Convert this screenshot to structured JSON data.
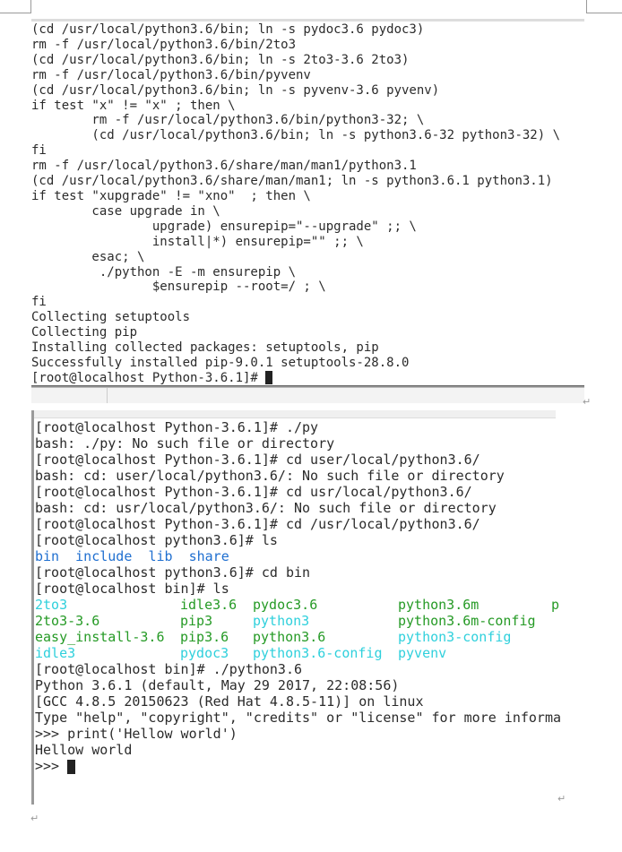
{
  "terminal_top": {
    "lines": [
      "(cd /usr/local/python3.6/bin; ln -s pydoc3.6 pydoc3)",
      "rm -f /usr/local/python3.6/bin/2to3",
      "(cd /usr/local/python3.6/bin; ln -s 2to3-3.6 2to3)",
      "rm -f /usr/local/python3.6/bin/pyvenv",
      "(cd /usr/local/python3.6/bin; ln -s pyvenv-3.6 pyvenv)",
      "if test \"x\" != \"x\" ; then \\",
      "        rm -f /usr/local/python3.6/bin/python3-32; \\",
      "        (cd /usr/local/python3.6/bin; ln -s python3.6-32 python3-32) \\",
      "fi",
      "rm -f /usr/local/python3.6/share/man/man1/python3.1",
      "(cd /usr/local/python3.6/share/man/man1; ln -s python3.6.1 python3.1)",
      "if test \"xupgrade\" != \"xno\"  ; then \\",
      "        case upgrade in \\",
      "                upgrade) ensurepip=\"--upgrade\" ;; \\",
      "                install|*) ensurepip=\"\" ;; \\",
      "        esac; \\",
      "         ./python -E -m ensurepip \\",
      "                $ensurepip --root=/ ; \\",
      "fi",
      "Collecting setuptools",
      "Collecting pip",
      "Installing collected packages: setuptools, pip",
      "Successfully installed pip-9.0.1 setuptools-28.8.0",
      "[root@localhost Python-3.6.1]# "
    ]
  },
  "terminal_bottom": {
    "lines_before": [
      "[root@localhost Python-3.6.1]# ./py",
      "bash: ./py: No such file or directory",
      "[root@localhost Python-3.6.1]# cd user/local/python3.6/",
      "bash: cd: user/local/python3.6/: No such file or directory",
      "[root@localhost Python-3.6.1]# cd usr/local/python3.6/",
      "bash: cd: usr/local/python3.6/: No such file or directory",
      "[root@localhost Python-3.6.1]# cd /usr/local/python3.6/",
      "[root@localhost python3.6]# ls"
    ],
    "dir_listing": [
      {
        "name": "bin",
        "type": "dir"
      },
      {
        "name": "include",
        "type": "dir"
      },
      {
        "name": "lib",
        "type": "dir"
      },
      {
        "name": "share",
        "type": "dir"
      }
    ],
    "lines_middle": [
      "[root@localhost python3.6]# cd bin",
      "[root@localhost bin]# ls"
    ],
    "bin_listing": [
      [
        {
          "name": "2to3",
          "type": "link"
        },
        {
          "name": "idle3.6",
          "type": "exe"
        },
        {
          "name": "pydoc3.6",
          "type": "exe"
        },
        {
          "name": "python3.6m",
          "type": "exe"
        },
        {
          "name": "p",
          "type": "exe"
        }
      ],
      [
        {
          "name": "2to3-3.6",
          "type": "exe"
        },
        {
          "name": "pip3",
          "type": "exe"
        },
        {
          "name": "python3",
          "type": "link"
        },
        {
          "name": "python3.6m-config",
          "type": "exe"
        }
      ],
      [
        {
          "name": "easy_install-3.6",
          "type": "exe"
        },
        {
          "name": "pip3.6",
          "type": "exe"
        },
        {
          "name": "python3.6",
          "type": "exe"
        },
        {
          "name": "python3-config",
          "type": "link"
        }
      ],
      [
        {
          "name": "idle3",
          "type": "link"
        },
        {
          "name": "pydoc3",
          "type": "link"
        },
        {
          "name": "python3.6-config",
          "type": "link"
        },
        {
          "name": "pyvenv",
          "type": "link"
        }
      ]
    ],
    "lines_after": [
      "[root@localhost bin]# ./python3.6",
      "Python 3.6.1 (default, May 29 2017, 22:08:56)",
      "[GCC 4.8.5 20150623 (Red Hat 4.8.5-11)] on linux",
      "Type \"help\", \"copyright\", \"credits\" or \"license\" for more informa",
      ">>> print('Hellow world')",
      "Hellow world",
      ">>> "
    ]
  },
  "colors": {
    "dir": "#1f6fd0",
    "exe": "#259a25",
    "link": "#2fd0dc"
  },
  "paragraph_mark": "↵"
}
